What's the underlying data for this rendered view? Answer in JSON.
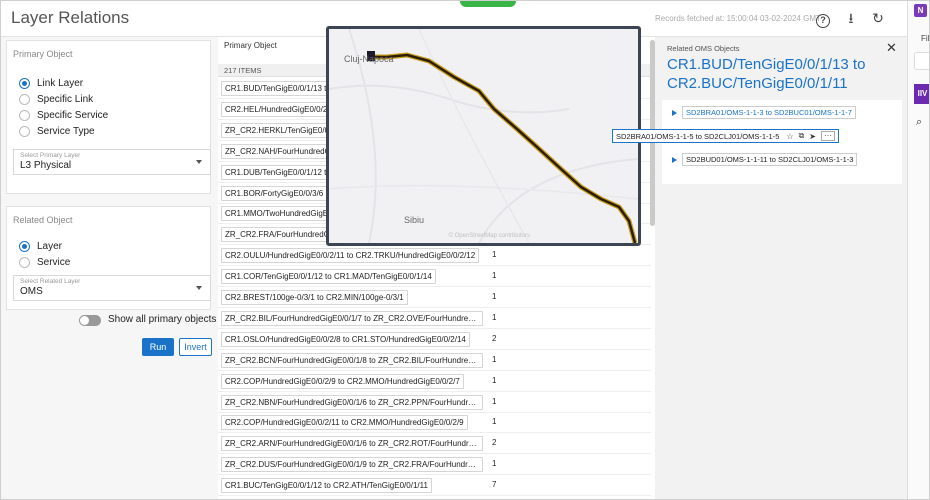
{
  "header": {
    "title": "Layer Relations",
    "records_fetched": "Records fetched at: 15:00:04 03-02-2024 GMT",
    "icons": [
      "help-icon",
      "download-icon",
      "refresh-icon"
    ],
    "help_glyph": "?",
    "download_glyph": "⭳",
    "refresh_glyph": "↻"
  },
  "primary_object": {
    "title": "Primary Object",
    "options": [
      "Link Layer",
      "Specific Link",
      "Specific Service",
      "Service Type"
    ],
    "selected": "Link Layer",
    "layer_select": {
      "label": "Select Primary Layer",
      "value": "L3 Physical"
    }
  },
  "related_object": {
    "title": "Related Object",
    "options": [
      "Layer",
      "Service"
    ],
    "selected": "Layer",
    "layer_select": {
      "label": "Select Related Layer",
      "value": "OMS"
    }
  },
  "controls": {
    "show_all_label": "Show all primary objects",
    "run_label": "Run",
    "invert_label": "Invert"
  },
  "table": {
    "column_header": "Primary Object",
    "items_count": "217 ITEMS",
    "rows": [
      {
        "link": "CR1.BUD/TenGigE0/0/1/13 to",
        "count": ""
      },
      {
        "link": "CR2.HEL/HundredGigE0/0/2",
        "count": ""
      },
      {
        "link": "ZR_CR2.HERKL/TenGigE0/0",
        "count": ""
      },
      {
        "link": "ZR_CR2.NAH/FourHundredGi",
        "count": ""
      },
      {
        "link": "CR1.DUB/TenGigE0/0/1/12 t",
        "count": ""
      },
      {
        "link": "CR1.BOR/FortyGigE0/0/3/6",
        "count": ""
      },
      {
        "link": "CR1.MMO/TwoHundredGigE",
        "count": ""
      },
      {
        "link": "ZR_CR2.FRA/FourHundredG",
        "count": ""
      },
      {
        "link": "CR2.OULU/HundredGigE0/0/2/11 to CR2.TRKU/HundredGigE0/0/2/12",
        "count": "1"
      },
      {
        "link": "CR1.COR/TenGigE0/0/1/12 to CR1.MAD/TenGigE0/0/1/14",
        "count": "1"
      },
      {
        "link": "CR2.BREST/100ge-0/3/1 to CR2.MIN/100ge-0/3/1",
        "count": "1"
      },
      {
        "link": "ZR_CR2.BIL/FourHundredGigE0/0/1/7 to ZR_CR2.OVE/FourHundred...",
        "count": "1"
      },
      {
        "link": "CR1.OSLO/HundredGigE0/0/2/8 to CR1.STO/HundredGigE0/0/2/14",
        "count": "2"
      },
      {
        "link": "ZR_CR2.BCN/FourHundredGigE0/0/1/8 to ZR_CR2.BIL/FourHundred...",
        "count": "1"
      },
      {
        "link": "CR2.COP/HundredGigE0/0/2/9 to CR2.MMO/HundredGigE0/0/2/7",
        "count": "1"
      },
      {
        "link": "ZR_CR2.NBN/FourHundredGigE0/0/1/6 to ZR_CR2.PPN/FourHundred...",
        "count": "1"
      },
      {
        "link": "CR2.COP/HundredGigE0/0/2/11 to CR2.MMO/HundredGigE0/0/2/9",
        "count": "1"
      },
      {
        "link": "ZR_CR2.ARN/FourHundredGigE0/0/1/6 to ZR_CR2.ROT/FourHundre...",
        "count": "2"
      },
      {
        "link": "ZR_CR2.DUS/FourHundredGigE0/0/1/9 to ZR_CR2.FRA/FourHundred...",
        "count": "1"
      },
      {
        "link": "CR1.BUC/TenGigE0/0/1/12 to CR2.ATH/TenGigE0/0/1/11",
        "count": "7"
      }
    ]
  },
  "map": {
    "city_top": "Cluj-Napoca",
    "city_bottom": "Sibiu",
    "credit": "© OpenStreetMap contributors",
    "route_color": "#2b1d08",
    "route_outline_color": "#c8a020"
  },
  "related_panel": {
    "label": "Related OMS Objects",
    "title": "CR1.BUD/TenGigE0/0/1/13 to CR2.BUC/TenGigE0/0/1/11",
    "items": [
      "SD2BRA01/OMS-1-1-3 to SD2BUC01/OMS-1-1-7",
      "SD2BUD01/OMS-1-1-11 to SD2CLJ01/OMS-1-1-3"
    ],
    "tooltip": "SD2BRA01/OMS-1-1-5 to SD2CLJ01/OMS-1-1-5",
    "tooltip_icons": [
      "star-icon",
      "external-link-icon",
      "navigate-icon",
      "more-icon"
    ],
    "close_glyph": "✕"
  },
  "edge": {
    "onenote": "N",
    "file_label": "Fil"
  },
  "colors": {
    "accent": "#1a73c9",
    "green": "#3ab54a"
  }
}
